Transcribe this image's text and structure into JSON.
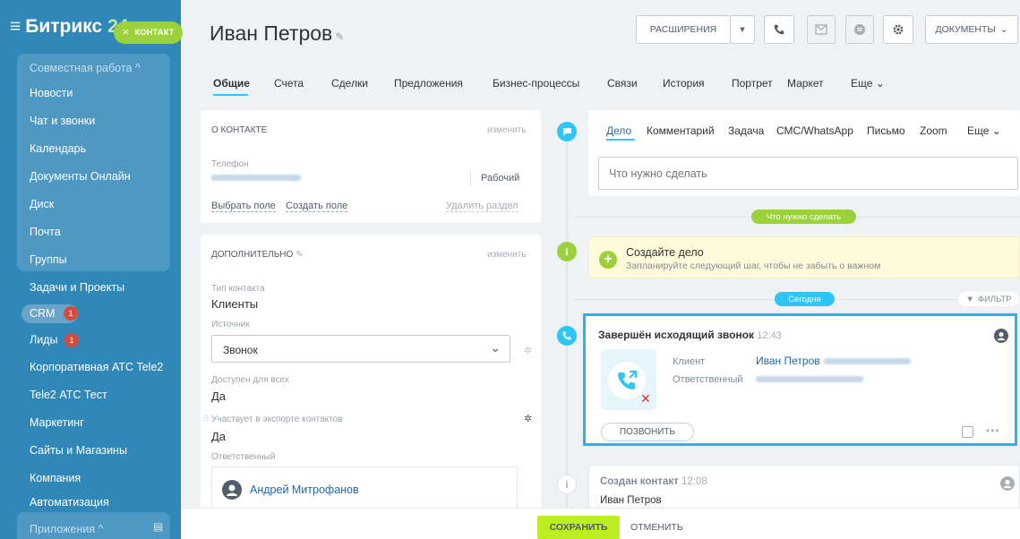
{
  "sidebar": {
    "logo": "Битрикс",
    "logo_num": "24",
    "badge": "КОНТАКТ",
    "group_label": "Совместная работа ^",
    "items": [
      "Новости",
      "Чат и звонки",
      "Календарь",
      "Документы Онлайн",
      "Диск",
      "Почта",
      "Группы"
    ],
    "tasks": "Задачи и Проекты",
    "crm": "CRM",
    "crm_count": "1",
    "leads": "Лиды",
    "leads_count": "1",
    "more_items": [
      "Корпоративная АТС Tele2",
      "Tele2 АТС Тест",
      "Маркетинг",
      "Сайты и Магазины",
      "Компания",
      "Автоматизация"
    ],
    "apps_label": "Приложения ^"
  },
  "header": {
    "title": "Иван Петров",
    "extensions": "РАСШИРЕНИЯ",
    "documents": "ДОКУМЕНТЫ"
  },
  "tabs": [
    "Общие",
    "Счета",
    "Сделки",
    "Предложения",
    "Бизнес-процессы",
    "Связи",
    "История",
    "Портрет",
    "Маркет",
    "Еще"
  ],
  "about": {
    "header": "О КОНТАКТЕ",
    "edit": "изменить",
    "phone_label": "Телефон",
    "phone_type": "Рабочий",
    "choose_field": "Выбрать поле",
    "create_field": "Создать поле",
    "delete_section": "Удалить раздел"
  },
  "extra": {
    "header": "ДОПОЛНИТЕЛЬНО",
    "edit": "изменить",
    "type_label": "Тип контакта",
    "type_value": "Клиенты",
    "source_label": "Источник",
    "source_value": "Звонок",
    "available_label": "Доступен для всех",
    "available_value": "Да",
    "export_label": "Участвует в экспорте контактов",
    "export_value": "Да",
    "responsible_label": "Ответственный",
    "responsible_value": "Андрей Митрофанов"
  },
  "activity": {
    "tabs": [
      "Дело",
      "Комментарий",
      "Задача",
      "СМС/WhatsApp",
      "Письмо",
      "Zoom",
      "Еще"
    ],
    "placeholder": "Что нужно сделать",
    "todo_pill": "Что нужно сделать",
    "create_title": "Создайте дело",
    "create_sub": "Запланируйте следующий шаг, чтобы не забыть о важном",
    "today": "Сегодня",
    "filter": "ФИЛЬТР"
  },
  "call": {
    "title": "Завершён исходящий звонок",
    "time": "12:43",
    "client_label": "Клиент",
    "client_value": "Иван Петров",
    "responsible_label": "Ответственный",
    "call_button": "ПОЗВОНИТЬ"
  },
  "created": {
    "title": "Создан контакт",
    "time": "12:08",
    "name": "Иван Петров"
  },
  "footer": {
    "save": "СОХРАНИТЬ",
    "cancel": "ОТМЕНИТЬ"
  },
  "colors": {
    "sidebar": "#2f88b8",
    "accent_green": "#9bd23c",
    "accent_blue": "#2fc6f6",
    "highlight": "#29b4e6"
  }
}
